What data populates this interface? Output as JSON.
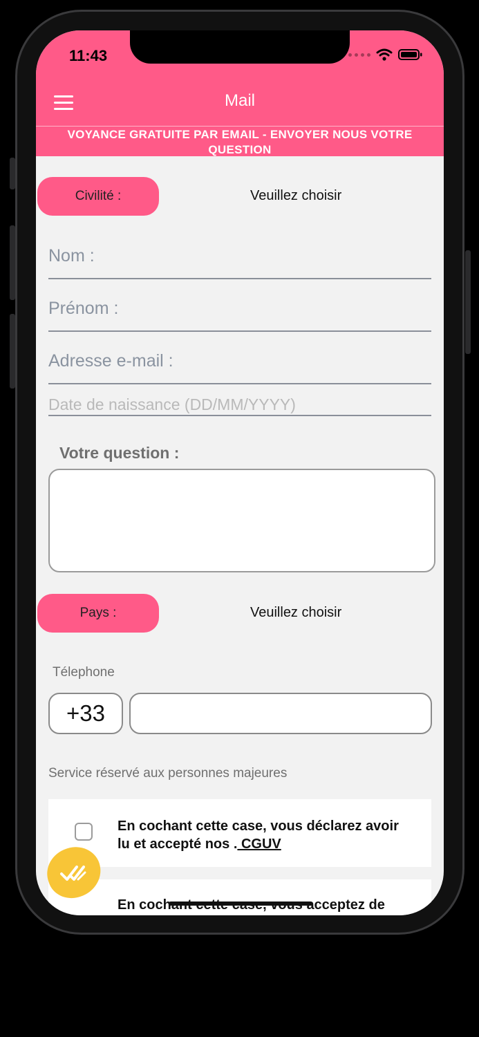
{
  "status_bar": {
    "time": "11:43"
  },
  "header": {
    "title": "Mail",
    "banner": "VOYANCE GRATUITE PAR EMAIL - ENVOYER NOUS VOTRE QUESTION"
  },
  "form": {
    "civility": {
      "label": "Civilité :",
      "value": "Veuillez choisir"
    },
    "nom": {
      "placeholder": "Nom :"
    },
    "prenom": {
      "placeholder": "Prénom :"
    },
    "email": {
      "placeholder": "Adresse e-mail :"
    },
    "birthdate": {
      "placeholder": "Date de naissance (DD/MM/YYYY)"
    },
    "question": {
      "label": "Votre question :"
    },
    "country": {
      "label": "Pays :",
      "value": "Veuillez choisir"
    },
    "telephone": {
      "label": "Télephone",
      "code": "+33"
    },
    "majors_notice": "Service réservé aux personnes majeures",
    "cguv": {
      "text": "En cochant cette case, vous déclarez avoir lu et accepté nos .",
      "link": " CGUV"
    },
    "consent2": {
      "text": "En cochant cette case, vous acceptez de"
    }
  },
  "colors": {
    "brand": "#ff5a88",
    "fab": "#f8c537",
    "background": "#f2f2f2"
  },
  "icons": {
    "menu": "hamburger-menu-icon",
    "fab": "double-check-icon",
    "wifi": "wifi-icon",
    "battery": "battery-icon",
    "signal": "signal-dots-icon"
  }
}
